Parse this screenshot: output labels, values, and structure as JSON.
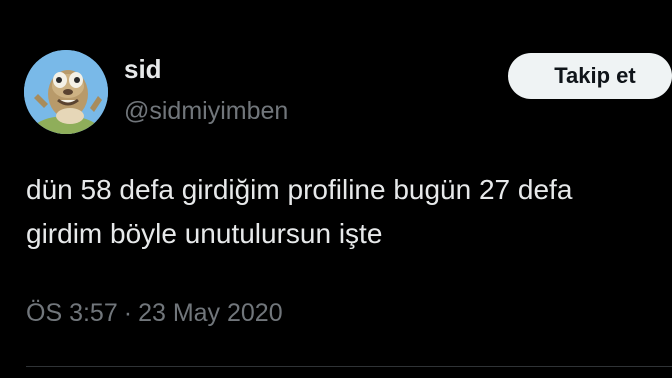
{
  "user": {
    "display_name": "sid",
    "handle": "@sidmiyimben",
    "avatar_icon": "sloth-avatar"
  },
  "follow_button": {
    "label": "Takip et"
  },
  "tweet": {
    "text": "dün 58 defa girdiğim profiline bugün 27 defa girdim böyle unutulursun işte",
    "time": "ÖS 3:57",
    "separator": "·",
    "date": "23 May 2020"
  },
  "colors": {
    "background": "#000000",
    "primary_text": "#e7e9ea",
    "secondary_text": "#71767b",
    "button_bg": "#eff3f4",
    "button_text": "#0f1419",
    "divider": "#2f3336"
  }
}
